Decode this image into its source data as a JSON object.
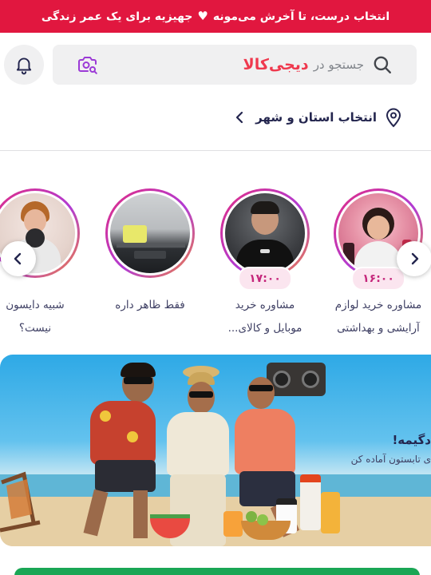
{
  "promo": {
    "text_a": "انتخاب درست، تا آخرش می‌مونه",
    "text_b": "جهیزیه برای یک عمر زندگی",
    "heart": "♥"
  },
  "search": {
    "placeholder": "جستجو در",
    "brand": "دیجی‌کالا",
    "icons": [
      "search-icon",
      "camera-search-icon",
      "bell-icon"
    ]
  },
  "location": {
    "label": "انتخاب استان و شهر",
    "icons": [
      "location-pin-icon",
      "chevron-left-icon"
    ]
  },
  "stories": [
    {
      "badge": "۱۶:۰۰",
      "line1": "مشاوره خرید لوازم",
      "line2": "آرایشی و بهداشتی"
    },
    {
      "badge": "۱۷:۰۰",
      "line1": "مشاوره خرید",
      "line2": "موبایل و کالای..."
    },
    {
      "badge": "",
      "line1": "فقط ظاهر داره",
      "line2": ""
    },
    {
      "badge": "",
      "line1": "شبیه دایسون",
      "line2": "نیست؟"
    }
  ],
  "banner": {
    "headline": "دگیمه!",
    "subline": "ی تابستون آماده کن"
  },
  "colors": {
    "accent": "#ef394e",
    "promo_bg": "#e1173f",
    "badge_bg": "#fbe5ef",
    "badge_text": "#c5267b"
  }
}
